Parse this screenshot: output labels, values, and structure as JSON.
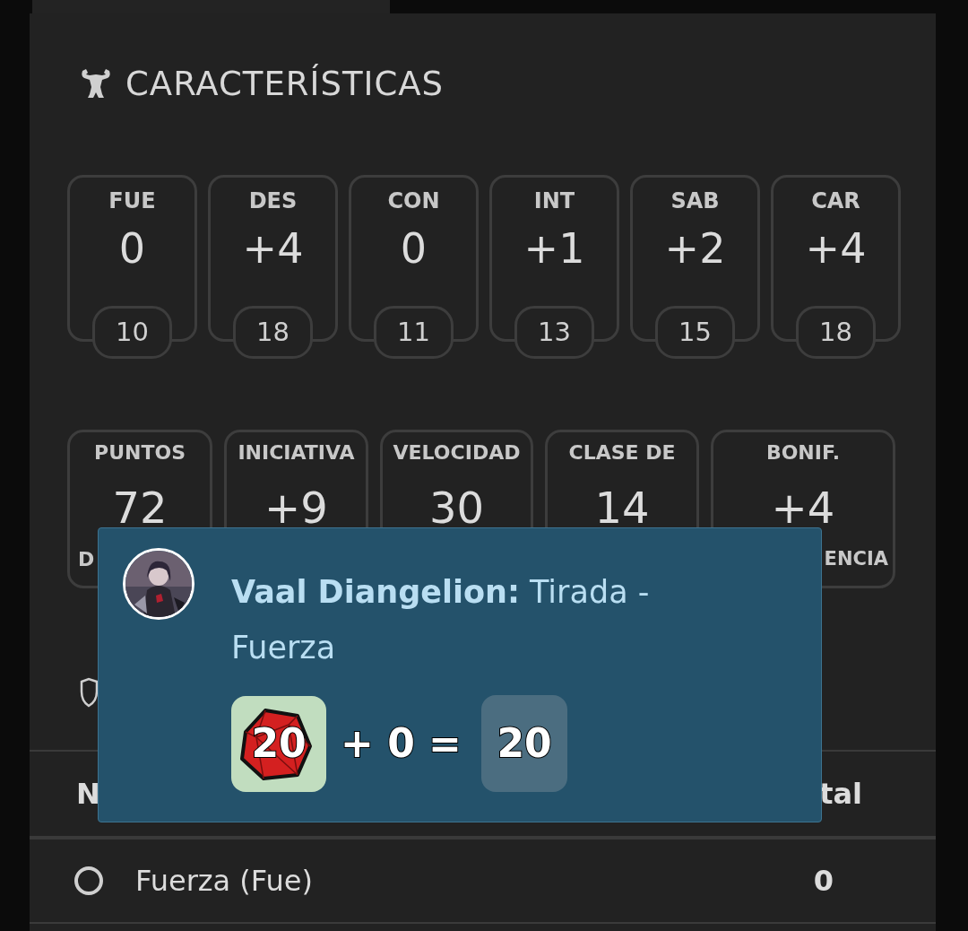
{
  "section": {
    "title": "CARACTERÍSTICAS"
  },
  "abilities": [
    {
      "abbr": "FUE",
      "modifier": "0",
      "score": "10"
    },
    {
      "abbr": "DES",
      "modifier": "+4",
      "score": "18"
    },
    {
      "abbr": "CON",
      "modifier": "0",
      "score": "11"
    },
    {
      "abbr": "INT",
      "modifier": "+1",
      "score": "13"
    },
    {
      "abbr": "SAB",
      "modifier": "+2",
      "score": "15"
    },
    {
      "abbr": "CAR",
      "modifier": "+4",
      "score": "18"
    }
  ],
  "stats": [
    {
      "label": "PUNTOS",
      "value": "72",
      "sublabel": "D"
    },
    {
      "label": "INICIATIVA",
      "value": "+9"
    },
    {
      "label": "VELOCIDAD",
      "value": "30"
    },
    {
      "label": "CLASE DE",
      "value": "14"
    },
    {
      "label": "BONIF.",
      "value": "+4",
      "sublabel": "ENCIA"
    }
  ],
  "table": {
    "columns": [
      "N",
      "tal"
    ],
    "rows": [
      {
        "name": "Fuerza (Fue)",
        "value": "0",
        "selected": false
      }
    ]
  },
  "roll_popup": {
    "speaker": "Vaal Diangelion:",
    "action": "Tirada - Fuerza",
    "die": "20",
    "operation": "+ 0 =",
    "total": "20"
  }
}
